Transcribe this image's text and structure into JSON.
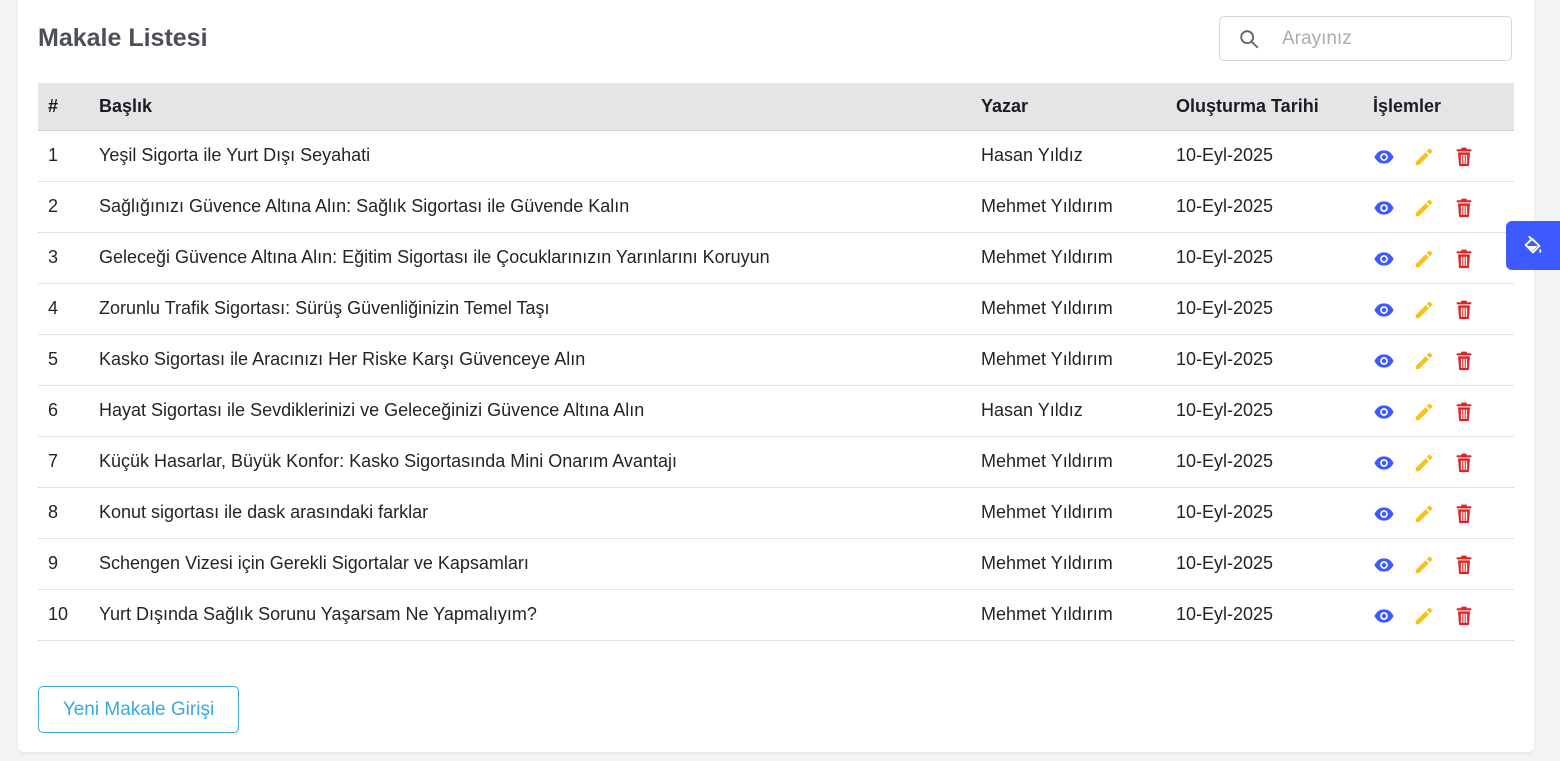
{
  "page": {
    "title": "Makale Listesi"
  },
  "search": {
    "placeholder": "Arayınız",
    "value": ""
  },
  "table": {
    "headers": {
      "no": "#",
      "title": "Başlık",
      "author": "Yazar",
      "date": "Oluşturma Tarihi",
      "actions": "İşlemler"
    },
    "rows": [
      {
        "no": "1",
        "title": "Yeşil Sigorta ile Yurt Dışı Seyahati",
        "author": "Hasan Yıldız",
        "date": "10-Eyl-2025"
      },
      {
        "no": "2",
        "title": "Sağlığınızı Güvence Altına Alın: Sağlık Sigortası ile Güvende Kalın",
        "author": "Mehmet Yıldırım",
        "date": "10-Eyl-2025"
      },
      {
        "no": "3",
        "title": "Geleceği Güvence Altına Alın: Eğitim Sigortası ile Çocuklarınızın Yarınlarını Koruyun",
        "author": "Mehmet Yıldırım",
        "date": "10-Eyl-2025"
      },
      {
        "no": "4",
        "title": "Zorunlu Trafik Sigortası: Sürüş Güvenliğinizin Temel Taşı",
        "author": "Mehmet Yıldırım",
        "date": "10-Eyl-2025"
      },
      {
        "no": "5",
        "title": "Kasko Sigortası ile Aracınızı Her Riske Karşı Güvenceye Alın",
        "author": "Mehmet Yıldırım",
        "date": "10-Eyl-2025"
      },
      {
        "no": "6",
        "title": "Hayat Sigortası ile Sevdiklerinizi ve Geleceğinizi Güvence Altına Alın",
        "author": "Hasan Yıldız",
        "date": "10-Eyl-2025"
      },
      {
        "no": "7",
        "title": "Küçük Hasarlar, Büyük Konfor: Kasko Sigortasında Mini Onarım Avantajı",
        "author": "Mehmet Yıldırım",
        "date": "10-Eyl-2025"
      },
      {
        "no": "8",
        "title": "Konut sigortası ile dask arasındaki farklar",
        "author": "Mehmet Yıldırım",
        "date": "10-Eyl-2025"
      },
      {
        "no": "9",
        "title": "Schengen Vizesi için Gerekli Sigortalar ve Kapsamları",
        "author": "Mehmet Yıldırım",
        "date": "10-Eyl-2025"
      },
      {
        "no": "10",
        "title": "Yurt Dışında Sağlık Sorunu Yaşarsam Ne Yapmalıyım?",
        "author": "Mehmet Yıldırım",
        "date": "10-Eyl-2025"
      }
    ]
  },
  "actions": {
    "icons": [
      "eye-icon",
      "pencil-icon",
      "trash-icon"
    ],
    "colors": {
      "view": "#3d5afe",
      "edit": "#f7c21b",
      "delete": "#e02424"
    }
  },
  "buttons": {
    "new_article": "Yeni Makale Girişi"
  },
  "floating": {
    "icon": "paint-bucket-icon",
    "color": "#3d5afe"
  },
  "colors": {
    "accent": "#3aa9e0",
    "header_bg": "#e4e5e7"
  }
}
